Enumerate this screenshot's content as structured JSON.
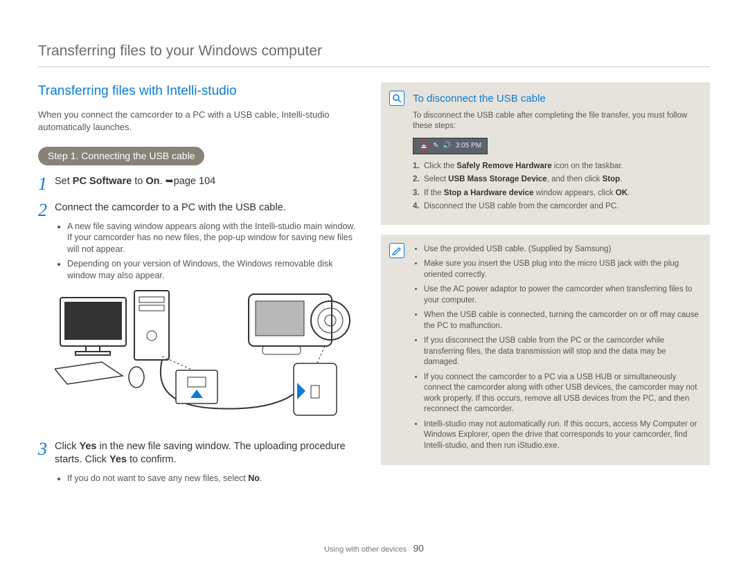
{
  "page_title": "Transferring files to your Windows computer",
  "left": {
    "section_title": "Transferring files with Intelli-studio",
    "intro": "When you connect the camcorder to a PC with a USB cable, Intelli-studio automatically launches.",
    "step_badge": "Step 1. Connecting the USB cable",
    "step1_prefix": "Set ",
    "step1_bold1": "PC Software",
    "step1_mid": " to ",
    "step1_bold2": "On",
    "step1_suffix": ".  ",
    "step1_ref": "page 104",
    "step2": "Connect the camcorder to a PC with the USB cable.",
    "step2_sub1": "A new file saving window appears along with the Intelli-studio main window. If your camcorder has no new files, the pop-up window for saving new files will not appear.",
    "step2_sub2": "Depending on your version of Windows, the Windows removable disk window may also appear.",
    "step3_prefix": "Click ",
    "step3_bold1": "Yes",
    "step3_mid": " in the new file saving window. The uploading procedure starts. Click ",
    "step3_bold2": "Yes",
    "step3_suffix": " to confirm.",
    "step3_sub_prefix": "If you do not want to save any new files, select ",
    "step3_sub_bold": "No",
    "step3_sub_suffix": "."
  },
  "right": {
    "disconnect_title": "To disconnect the USB cable",
    "disconnect_intro": "To disconnect the USB cable after completing the file transfer, you must follow these steps:",
    "tray_time": "3:05 PM",
    "d1_pre": "Click the ",
    "d1_b": "Safely Remove Hardware",
    "d1_post": " icon on the taskbar.",
    "d2_pre": "Select ",
    "d2_b1": "USB Mass Storage Device",
    "d2_mid": ", and then click ",
    "d2_b2": "Stop",
    "d2_post": ".",
    "d3_pre": "If the ",
    "d3_b1": "Stop a Hardware device",
    "d3_mid": " window appears, click ",
    "d3_b2": "OK",
    "d3_post": ".",
    "d4": "Disconnect the USB cable from the camcorder and PC.",
    "notes": [
      "Use the provided USB cable. (Supplied by Samsung)",
      "Make sure you insert the USB plug into the micro USB jack with the plug oriented correctly.",
      "Use the AC power adaptor to power the camcorder when transferring files to your computer.",
      "When the USB cable is connected, turning the camcorder on or off may cause the PC to malfunction.",
      "If you disconnect the USB cable from the PC or the camcorder while transferring files, the data transmission will stop and the data may be damaged.",
      "If you connect the camcorder to a PC via a USB HUB or simultaneously connect the camcorder along with other USB devices, the camcorder may not work properly. If this occurs, remove all USB devices from the PC, and then reconnect the camcorder.",
      "Intelli-studio may not automatically run. If this occurs, access My Computer or Windows Explorer, open the drive that corresponds to your camcorder, find Intelli-studio, and then run iStudio.exe."
    ]
  },
  "footer_section": "Using with other devices",
  "page_number": "90"
}
